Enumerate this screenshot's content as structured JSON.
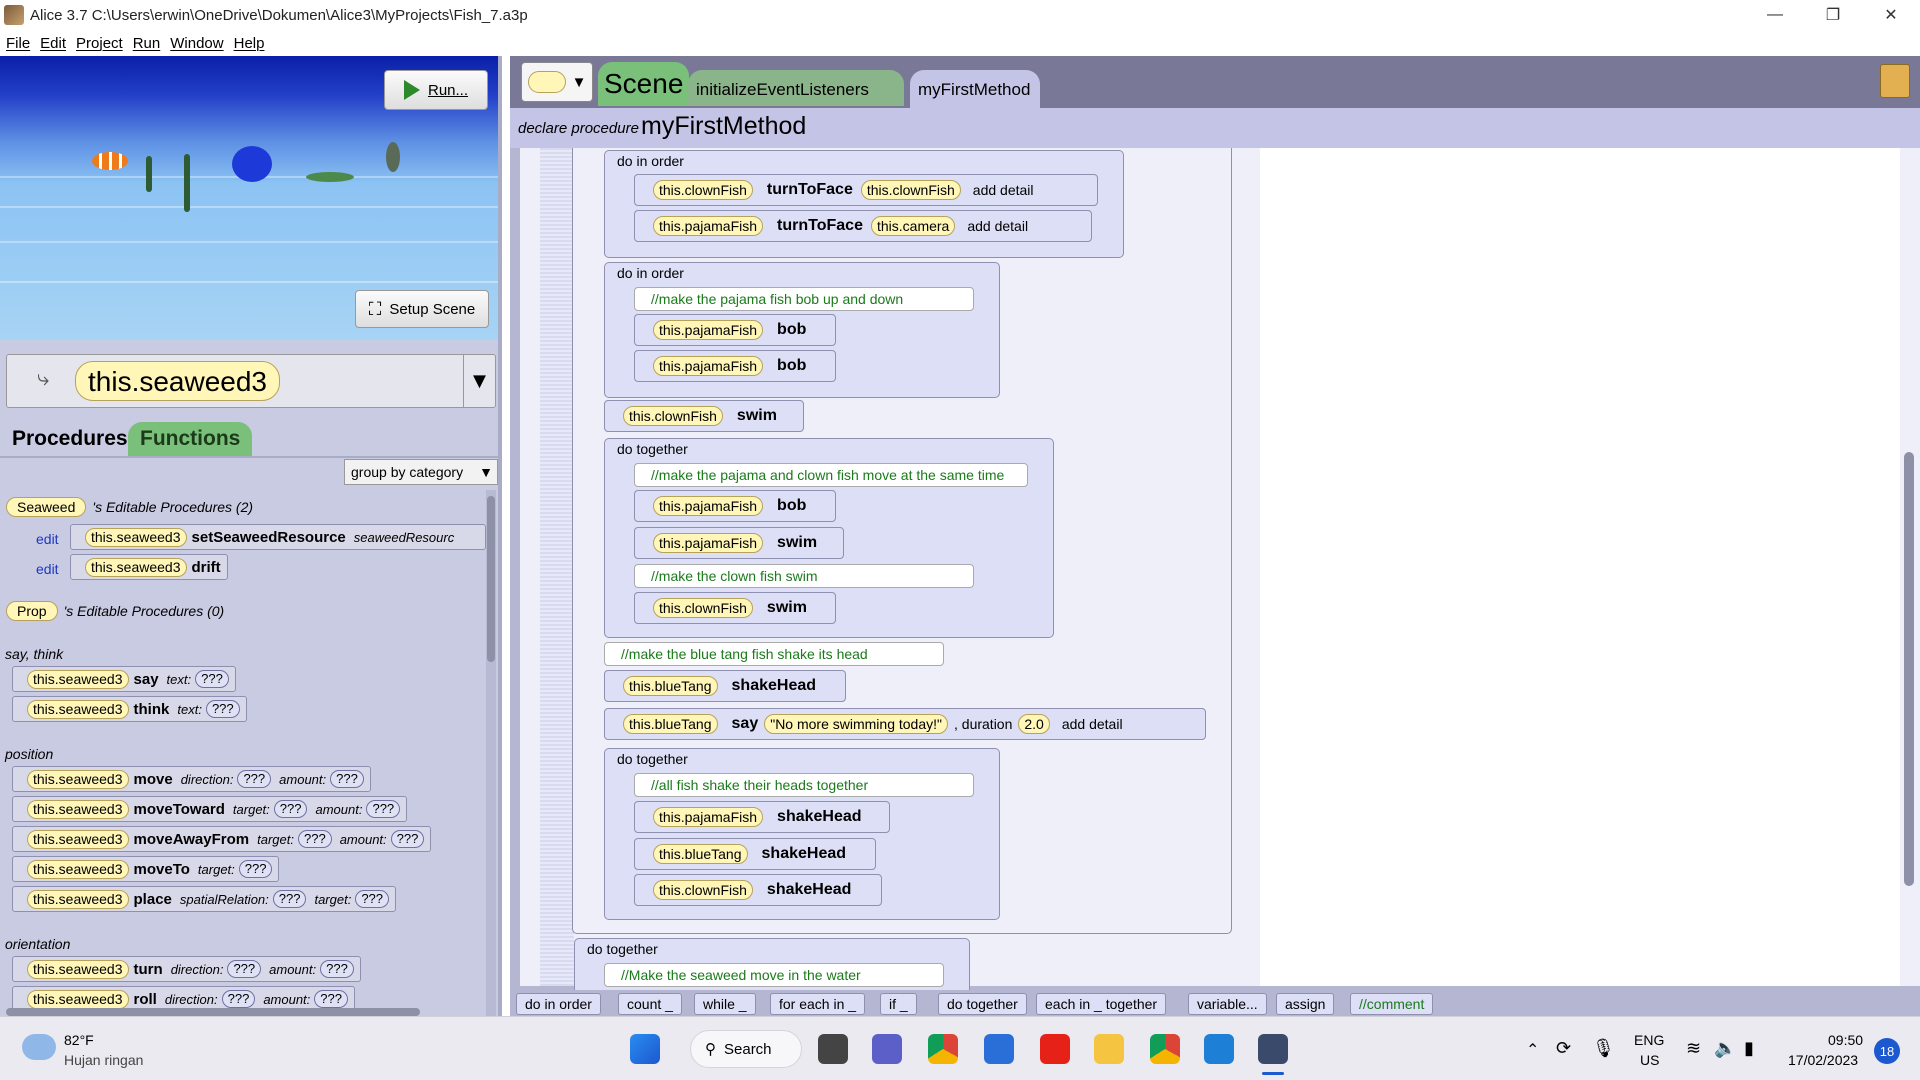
{
  "window": {
    "title": "Alice 3.7 C:\\Users\\erwin\\OneDrive\\Dokumen\\Alice3\\MyProjects\\Fish_7.a3p"
  },
  "menu": [
    "File",
    "Edit",
    "Project",
    "Run",
    "Window",
    "Help"
  ],
  "scene_view": {
    "run_label": "Run...",
    "setup_label": "Setup Scene"
  },
  "selector": {
    "value": "this.seaweed3"
  },
  "tabs": {
    "procedures": "Procedures",
    "functions": "Functions"
  },
  "group_by": "group by category",
  "editable": [
    {
      "type": "Seaweed",
      "label": "'s Editable Procedures (2)"
    },
    {
      "type": "Prop",
      "label": "'s Editable Procedures (0)"
    }
  ],
  "edit_label": "edit",
  "editable_procs": [
    {
      "obj": "this.seaweed3",
      "method": "setSeaweedResource",
      "arg": "seaweedResourc"
    },
    {
      "obj": "this.seaweed3",
      "method": "drift"
    }
  ],
  "categories": {
    "say": "say, think",
    "position": "position",
    "orientation": "orientation"
  },
  "procs": [
    {
      "obj": "this.seaweed3",
      "method": "say",
      "a1": "text:",
      "q1": "???"
    },
    {
      "obj": "this.seaweed3",
      "method": "think",
      "a1": "text:",
      "q1": "???"
    },
    {
      "obj": "this.seaweed3",
      "method": "move",
      "a1": "direction:",
      "q1": "???",
      "a2": "amount:",
      "q2": "???"
    },
    {
      "obj": "this.seaweed3",
      "method": "moveToward",
      "a1": "target:",
      "q1": "???",
      "a2": "amount:",
      "q2": "???"
    },
    {
      "obj": "this.seaweed3",
      "method": "moveAwayFrom",
      "a1": "target:",
      "q1": "???",
      "a2": "amount:",
      "q2": "???"
    },
    {
      "obj": "this.seaweed3",
      "method": "moveTo",
      "a1": "target:",
      "q1": "???"
    },
    {
      "obj": "this.seaweed3",
      "method": "place",
      "a1": "spatialRelation:",
      "q1": "???",
      "a2": "target:",
      "q2": "???"
    },
    {
      "obj": "this.seaweed3",
      "method": "turn",
      "a1": "direction:",
      "q1": "???",
      "a2": "amount:",
      "q2": "???"
    },
    {
      "obj": "this.seaweed3",
      "method": "roll",
      "a1": "direction:",
      "q1": "???",
      "a2": "amount:",
      "q2": "???"
    }
  ],
  "editor": {
    "scene_tab": "Scene",
    "tab_init": "initializeEventListeners",
    "tab_method": "myFirstMethod",
    "declare_label": "declare procedure",
    "method_name": "myFirstMethod"
  },
  "code": {
    "do_in_order": "do in order",
    "do_together": "do together",
    "add_detail": "add detail",
    "s1": {
      "obj": "this.clownFish",
      "method": "turnToFace",
      "target": "this.clownFish"
    },
    "s2": {
      "obj": "this.pajamaFish",
      "method": "turnToFace",
      "target": "this.camera"
    },
    "c1": "//make the pajama fish bob up and down",
    "s3": {
      "obj": "this.pajamaFish",
      "method": "bob"
    },
    "s4": {
      "obj": "this.pajamaFish",
      "method": "bob"
    },
    "s5": {
      "obj": "this.clownFish",
      "method": "swim"
    },
    "c2": "//make the pajama and clown fish move at the same time",
    "s6": {
      "obj": "this.pajamaFish",
      "method": "bob"
    },
    "s7": {
      "obj": "this.pajamaFish",
      "method": "swim"
    },
    "c3": "//make the clown fish swim",
    "s8": {
      "obj": "this.clownFish",
      "method": "swim"
    },
    "c4": "//make the blue tang fish shake its head",
    "s9": {
      "obj": "this.blueTang",
      "method": "shakeHead"
    },
    "s10": {
      "obj": "this.blueTang",
      "method": "say",
      "text": "\"No more swimming today!\"",
      "dur_label": ", duration",
      "dur": "2.0"
    },
    "c5": "//all fish shake their heads together",
    "s11": {
      "obj": "this.pajamaFish",
      "method": "shakeHead"
    },
    "s12": {
      "obj": "this.blueTang",
      "method": "shakeHead"
    },
    "s13": {
      "obj": "this.clownFish",
      "method": "shakeHead"
    },
    "c6": "//Make the seaweed move in the water"
  },
  "palette": [
    "do in order",
    "count _",
    "while _",
    "for each in _",
    "if _",
    "do together",
    "each in _ together",
    "variable...",
    "assign",
    "//comment"
  ],
  "taskbar": {
    "weather_temp": "82°F",
    "weather_desc": "Hujan ringan",
    "search": "Search",
    "lang1": "ENG",
    "lang2": "US",
    "time": "09:50",
    "date": "17/02/2023",
    "badge": "18"
  }
}
